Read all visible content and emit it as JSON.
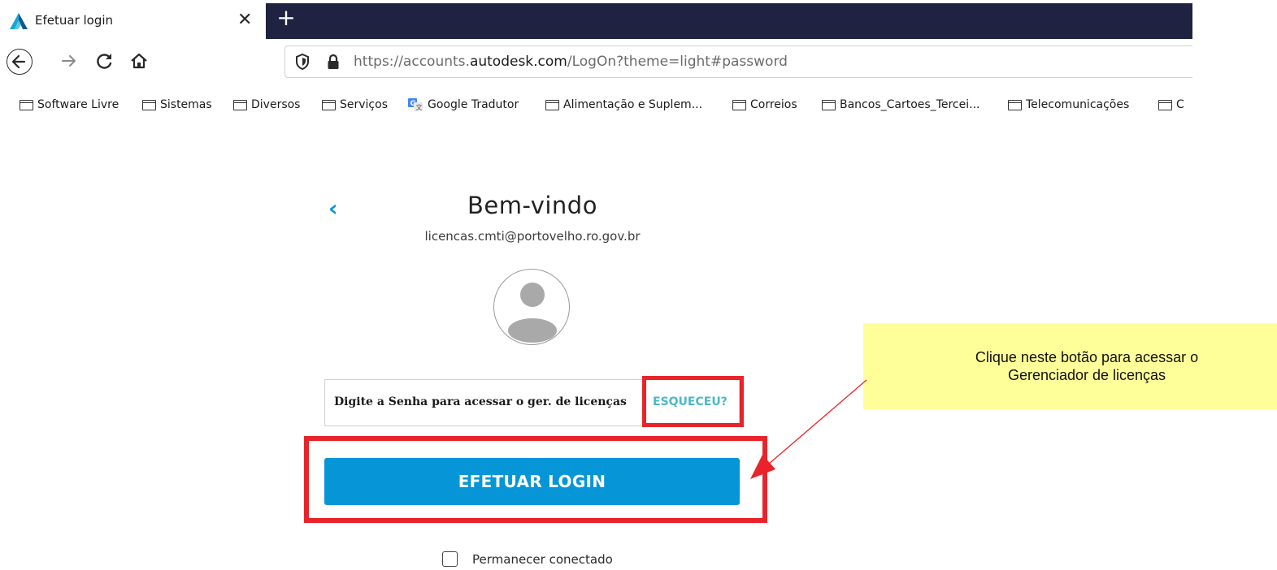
{
  "browser": {
    "tab": {
      "title": "Efetuar login",
      "close_icon": "close-icon"
    },
    "new_tab": "+",
    "url": {
      "prefix": "https://accounts.",
      "host": "autodesk.com",
      "suffix": "/LogOn?theme=light#password"
    },
    "bookmarks": [
      {
        "label": "Software Livre",
        "icon": "folder-icon"
      },
      {
        "label": "Sistemas",
        "icon": "folder-icon"
      },
      {
        "label": "Diversos",
        "icon": "folder-icon"
      },
      {
        "label": "Serviços",
        "icon": "folder-icon"
      },
      {
        "label": "Google Tradutor",
        "icon": "google-translate-icon"
      },
      {
        "label": "Alimentação e Suplem...",
        "icon": "folder-icon"
      },
      {
        "label": "Correios",
        "icon": "folder-icon"
      },
      {
        "label": "Bancos_Cartoes_Tercei...",
        "icon": "folder-icon"
      },
      {
        "label": "Telecomunicações",
        "icon": "folder-icon"
      },
      {
        "label": "C",
        "icon": "folder-icon"
      }
    ]
  },
  "login": {
    "title": "Bem-vindo",
    "email": "licencas.cmti@portovelho.ro.gov.br",
    "password_placeholder": "Digite a Senha para acessar o ger. de licenças",
    "forgot_label": "ESQUECEU?",
    "login_button": "EFETUAR LOGIN",
    "keep_connected": "Permanecer conectado"
  },
  "annotation": {
    "line1": "Clique neste botão para acessar o",
    "line2": "Gerenciador de licenças"
  },
  "colors": {
    "accent": "#0696d7",
    "highlight_red": "#e8242a",
    "note_yellow": "#ffff99",
    "tabbar_dark": "#1f2240"
  }
}
